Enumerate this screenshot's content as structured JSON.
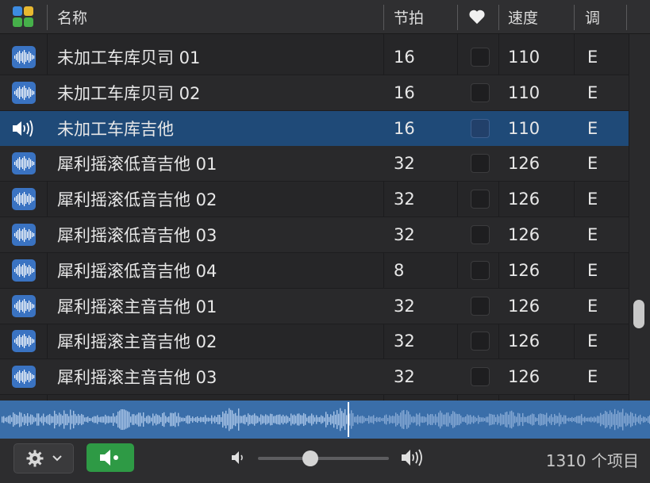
{
  "header": {
    "icon": "grid-quadrant-icon",
    "name": "名称",
    "beats": "节拍",
    "favorite_icon": "heart-icon",
    "tempo": "速度",
    "key": "调"
  },
  "rows": [
    {
      "icon": "waveform-icon",
      "name": "未加工车库贝司 01",
      "beats": "16",
      "tempo": "110",
      "key": "E",
      "selected": false
    },
    {
      "icon": "waveform-icon",
      "name": "未加工车库贝司 02",
      "beats": "16",
      "tempo": "110",
      "key": "E",
      "selected": false
    },
    {
      "icon": "speaker-playing-icon",
      "name": "未加工车库吉他",
      "beats": "16",
      "tempo": "110",
      "key": "E",
      "selected": true
    },
    {
      "icon": "waveform-icon",
      "name": "犀利摇滚低音吉他 01",
      "beats": "32",
      "tempo": "126",
      "key": "E",
      "selected": false
    },
    {
      "icon": "waveform-icon",
      "name": "犀利摇滚低音吉他 02",
      "beats": "32",
      "tempo": "126",
      "key": "E",
      "selected": false
    },
    {
      "icon": "waveform-icon",
      "name": "犀利摇滚低音吉他 03",
      "beats": "32",
      "tempo": "126",
      "key": "E",
      "selected": false
    },
    {
      "icon": "waveform-icon",
      "name": "犀利摇滚低音吉他 04",
      "beats": "8",
      "tempo": "126",
      "key": "E",
      "selected": false
    },
    {
      "icon": "waveform-icon",
      "name": "犀利摇滚主音吉他 01",
      "beats": "32",
      "tempo": "126",
      "key": "E",
      "selected": false
    },
    {
      "icon": "waveform-icon",
      "name": "犀利摇滚主音吉他 02",
      "beats": "32",
      "tempo": "126",
      "key": "E",
      "selected": false
    },
    {
      "icon": "waveform-icon",
      "name": "犀利摇滚主音吉他 03",
      "beats": "32",
      "tempo": "126",
      "key": "E",
      "selected": false
    }
  ],
  "footer": {
    "settings_icon": "gear-icon",
    "preview_icon": "speaker-preview-icon",
    "volume": 0.4,
    "count": "1310 个项目"
  },
  "colors": {
    "selection": "#1f4a78",
    "waveform_bg": "#3a6ea9",
    "preview_button": "#2e9a45",
    "icon_blue": "#3a73c2"
  }
}
